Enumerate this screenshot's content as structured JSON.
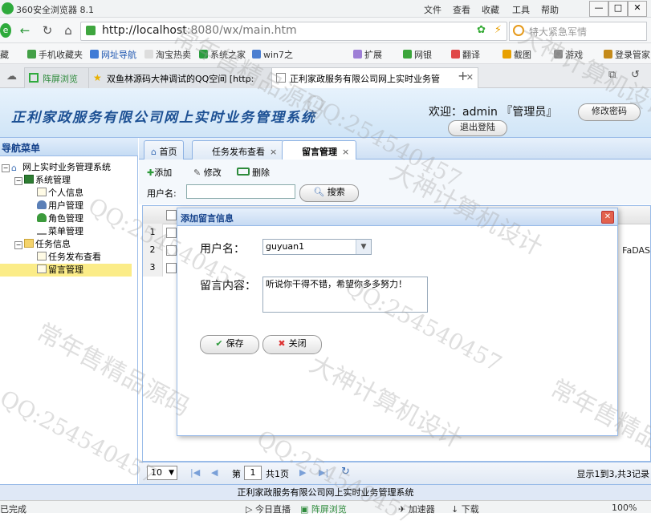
{
  "browser": {
    "title": "360安全浏览器 8.1",
    "menu": [
      "文件",
      "查看",
      "收藏",
      "工具",
      "帮助"
    ],
    "window_buttons": [
      "—",
      "□",
      "✕"
    ],
    "url_host": "http://localhost",
    "url_rest": ":8080/wx/main.htm",
    "search_placeholder": "特大紧急军情",
    "bookmarks": [
      "藏",
      "手机收藏夹",
      "网址导航",
      "淘宝热卖",
      "系统之家",
      "win7之",
      "扩展",
      "网银",
      "翻译",
      "截图",
      "游戏",
      "登录管家"
    ],
    "tabs": [
      {
        "label": "阵屏浏览",
        "active": false
      },
      {
        "label": "双鱼林源码大神调试的QQ空间 [http:",
        "active": false
      },
      {
        "label": "正利家政服务有限公司网上实时业务管",
        "active": true
      }
    ]
  },
  "header": {
    "title": "正利家政服务有限公司网上实时业务管理系统",
    "welcome": "欢迎：admin 『管理员』",
    "change_password": "修改密码",
    "logout": "退出登陆"
  },
  "nav": {
    "heading": "导航菜单",
    "collapse": "«",
    "root": "网上实时业务管理系统",
    "groups": [
      {
        "label": "系统管理",
        "items": [
          "个人信息",
          "用户管理",
          "角色管理",
          "菜单管理"
        ]
      },
      {
        "label": "任务信息",
        "items": [
          "任务发布查看",
          "留言管理"
        ]
      }
    ]
  },
  "main": {
    "tabs": [
      "首页",
      "任务发布查看",
      "留言管理"
    ],
    "toolbar": {
      "add": "添加",
      "edit": "修改",
      "delete": "删除",
      "username_label": "用户名:",
      "search": "搜索"
    },
    "rows": [
      "1",
      "2",
      "3"
    ],
    "row2_tail": "FaDAS",
    "pager": {
      "page_size": "10",
      "page_prefix": "第",
      "page": "1",
      "page_suffix": "共1页",
      "summary": "显示1到3,共3记录"
    }
  },
  "dialog": {
    "title": "添加留言信息",
    "username_label": "用户名：",
    "username_value": "guyuan1",
    "content_label": "留言内容：",
    "content_value": "听说你干得不错，希望你多多努力！",
    "save": "保存",
    "close": "关闭"
  },
  "footer": {
    "text": "正利家政服务有限公司网上实时业务管理系统"
  },
  "statusbar": {
    "left": "已完成",
    "items": [
      "今日直播",
      "阵屏浏览",
      "加速器",
      "下载",
      "100%"
    ]
  },
  "watermarks": [
    "QQ:254540457",
    "大神计算机设计",
    "常年售精品源码"
  ]
}
